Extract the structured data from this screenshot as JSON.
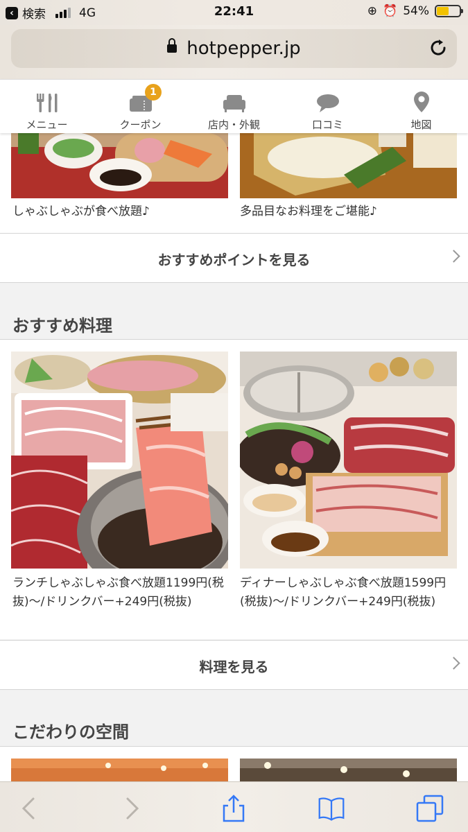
{
  "status": {
    "back_app_label": "検索",
    "network": "4G",
    "time": "22:41",
    "battery_percent_label": "54%",
    "battery_level": 0.54,
    "signal_bars_filled": 3
  },
  "browser": {
    "url": "hotpepper.jp"
  },
  "tabs": [
    {
      "label": "メニュー",
      "icon": "fork-knife-icon"
    },
    {
      "label": "クーポン",
      "icon": "coupon-ticket-icon",
      "badge": "1"
    },
    {
      "label": "店内・外観",
      "icon": "sofa-icon"
    },
    {
      "label": "口コミ",
      "icon": "speech-bubble-icon"
    },
    {
      "label": "地図",
      "icon": "map-pin-icon"
    }
  ],
  "points": {
    "items": [
      {
        "caption": "しゃぶしゃぶが食べ放題♪"
      },
      {
        "caption": "多品目なお料理をご堪能♪"
      }
    ],
    "link_label": "おすすめポイントを見る"
  },
  "dishes": {
    "title": "おすすめ料理",
    "items": [
      {
        "caption": "ランチしゃぶしゃぶ食べ放題1199円(税抜)〜/ドリンクバー+249円(税抜)"
      },
      {
        "caption": "ディナーしゃぶしゃぶ食べ放題1599円(税抜)〜/ドリンクバー+249円(税抜)"
      }
    ],
    "link_label": "料理を見る"
  },
  "space": {
    "title": "こだわりの空間"
  },
  "colors": {
    "badge": "#e8a21c",
    "accent_toolbar_icon": "#3478f6",
    "disabled_icon": "#b9b4ad"
  }
}
